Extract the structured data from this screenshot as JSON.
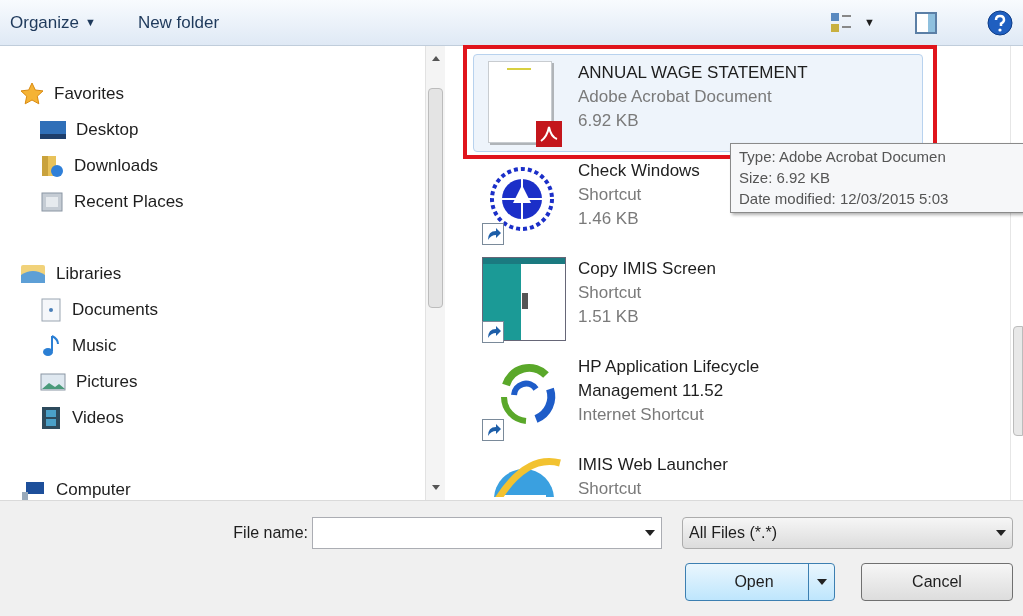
{
  "toolbar": {
    "organize": "Organize",
    "organize_caret": "▼",
    "new_folder": "New folder",
    "view_caret": "▼"
  },
  "navigation": [
    {
      "label": "Favorites",
      "children": [
        {
          "label": "Desktop"
        },
        {
          "label": "Downloads"
        },
        {
          "label": "Recent Places"
        }
      ]
    },
    {
      "label": "Libraries",
      "children": [
        {
          "label": "Documents"
        },
        {
          "label": "Music"
        },
        {
          "label": "Pictures"
        },
        {
          "label": "Videos"
        }
      ]
    },
    {
      "label": "Computer"
    }
  ],
  "files": [
    {
      "name": "ANNUAL WAGE STATEMENT",
      "type": "Adobe Acrobat Document",
      "size": "6.92 KB",
      "selected": true
    },
    {
      "name": "Check Windows",
      "type": "Shortcut",
      "size": "1.46 KB",
      "selected": false
    },
    {
      "name": "Copy IMIS Screen",
      "type": "Shortcut",
      "size": "1.51 KB",
      "selected": false
    },
    {
      "name": "HP Application Lifecycle Management 11.52",
      "type": "Internet Shortcut",
      "selected": false
    },
    {
      "name": "IMIS Web Launcher",
      "type": "Shortcut",
      "selected": false
    }
  ],
  "tooltip": [
    "Type: Adobe Acrobat Documen",
    "Size: 6.92 KB",
    "Date modified: 12/03/2015 5:03"
  ],
  "file_name": {
    "label": "File name:"
  },
  "file_type": {
    "value": "All Files (*.*)"
  },
  "buttons": {
    "open": "Open",
    "cancel": "Cancel"
  }
}
